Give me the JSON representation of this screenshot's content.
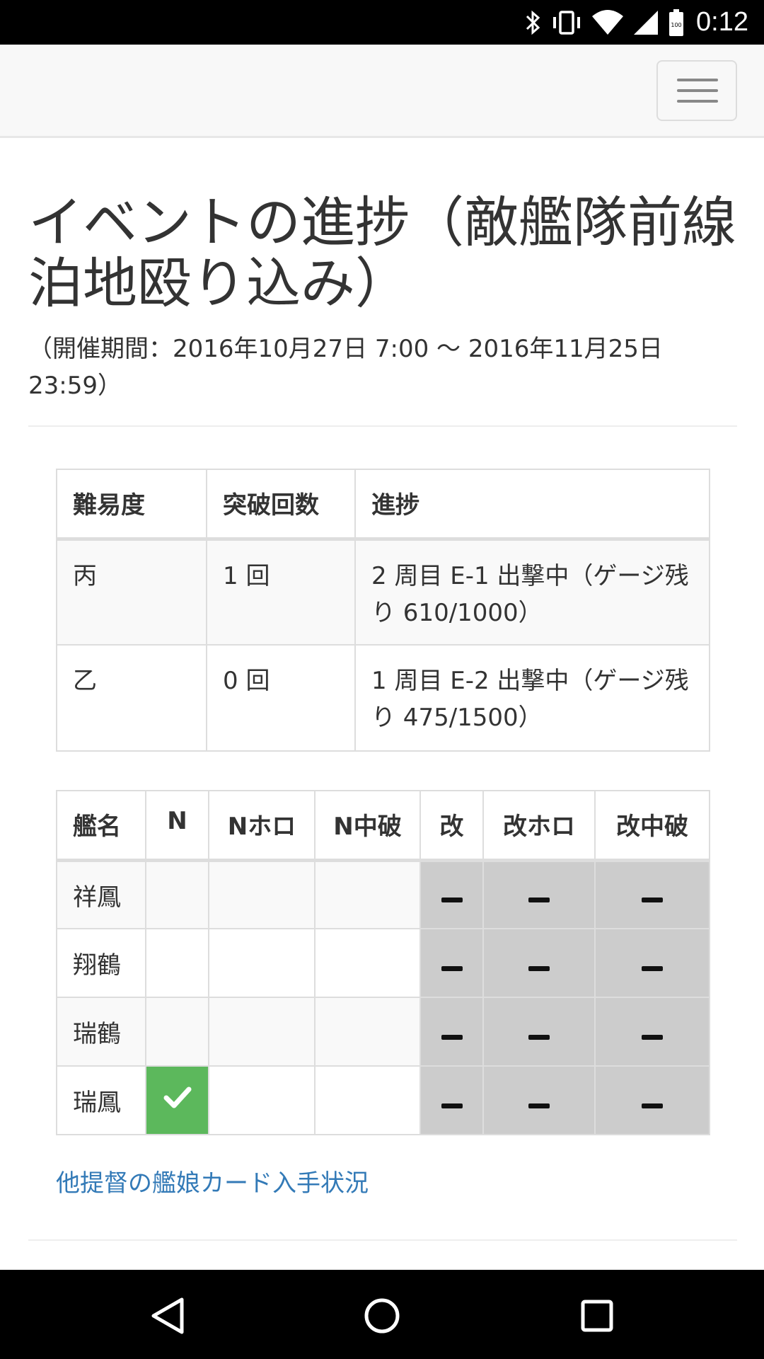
{
  "status_bar": {
    "time": "0:12",
    "battery_level": "100",
    "icons": [
      "bluetooth-icon",
      "vibrate-icon",
      "wifi-icon",
      "signal-icon",
      "battery-icon"
    ]
  },
  "navbar": {
    "toggle_icon": "hamburger-menu-icon"
  },
  "page": {
    "title": "イベントの進捗（敵艦隊前線泊地殴り込み）",
    "period": "（開催期間：2016年10月27日 7:00 〜 2016年11月25日 23:59）"
  },
  "progress_table": {
    "headers": [
      "難易度",
      "突破回数",
      "進捗"
    ],
    "rows": [
      [
        "丙",
        "1 回",
        "2 周目 E-1 出撃中（ゲージ残り 610/1000）"
      ],
      [
        "乙",
        "0 回",
        "1 周目 E-2 出撃中（ゲージ残り 475/1500）"
      ]
    ]
  },
  "card_table": {
    "headers": [
      "艦名",
      "N",
      "Nホロ",
      "N中破",
      "改",
      "改ホロ",
      "改中破"
    ],
    "rows": [
      {
        "name": "祥鳳",
        "n": false,
        "n_holo": false,
        "n_damaged": false,
        "kai": "n/a",
        "kai_holo": "n/a",
        "kai_damaged": "n/a"
      },
      {
        "name": "翔鶴",
        "n": false,
        "n_holo": false,
        "n_damaged": false,
        "kai": "n/a",
        "kai_holo": "n/a",
        "kai_damaged": "n/a"
      },
      {
        "name": "瑞鶴",
        "n": false,
        "n_holo": false,
        "n_damaged": false,
        "kai": "n/a",
        "kai_holo": "n/a",
        "kai_damaged": "n/a"
      },
      {
        "name": "瑞鳳",
        "n": true,
        "n_holo": false,
        "n_damaged": false,
        "kai": "n/a",
        "kai_holo": "n/a",
        "kai_damaged": "n/a"
      }
    ]
  },
  "link": {
    "text": "他提督の艦娘カード入手状況"
  },
  "colors": {
    "owned": "#5cb85c",
    "not_available": "#cccccc",
    "link": "#337ab7"
  },
  "nav_bar": {
    "icons": [
      "back-icon",
      "home-icon",
      "recents-icon"
    ]
  }
}
